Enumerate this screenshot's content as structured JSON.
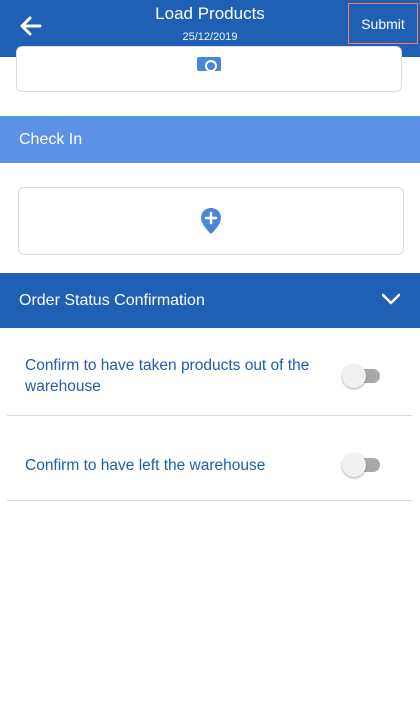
{
  "header": {
    "title": "Load Products",
    "date": "25/12/2019",
    "submit_label": "Submit"
  },
  "sections": {
    "check_in_label": "Check In",
    "order_status_label": "Order Status Confirmation"
  },
  "confirmations": [
    {
      "label": "Confirm to have taken products out of the warehouse",
      "checked": false
    },
    {
      "label": "Confirm to have left the warehouse",
      "checked": false
    }
  ],
  "colors": {
    "header": "#1f60b4",
    "section_light": "#5b92e5",
    "accent": "#4a86d8",
    "text_blue": "#1f5ea8",
    "submit_outline": "#ff7a59"
  },
  "icons": [
    "back-arrow-icon",
    "camera-icon",
    "location-pin-icon",
    "chevron-down-icon"
  ]
}
